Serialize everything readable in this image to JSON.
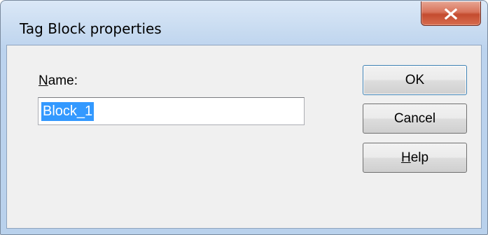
{
  "dialog": {
    "title": "Tag Block properties",
    "name_label_mnemonic": "N",
    "name_label_rest": "ame:",
    "name_value": "Block_1",
    "ok_label": "OK",
    "cancel_label": "Cancel",
    "help_mnemonic": "H",
    "help_rest": "elp"
  },
  "icons": {
    "close": "close-icon"
  },
  "colors": {
    "selection": "#3399ff",
    "close_button": "#c44b2f",
    "frame": "#b9d1ec"
  }
}
